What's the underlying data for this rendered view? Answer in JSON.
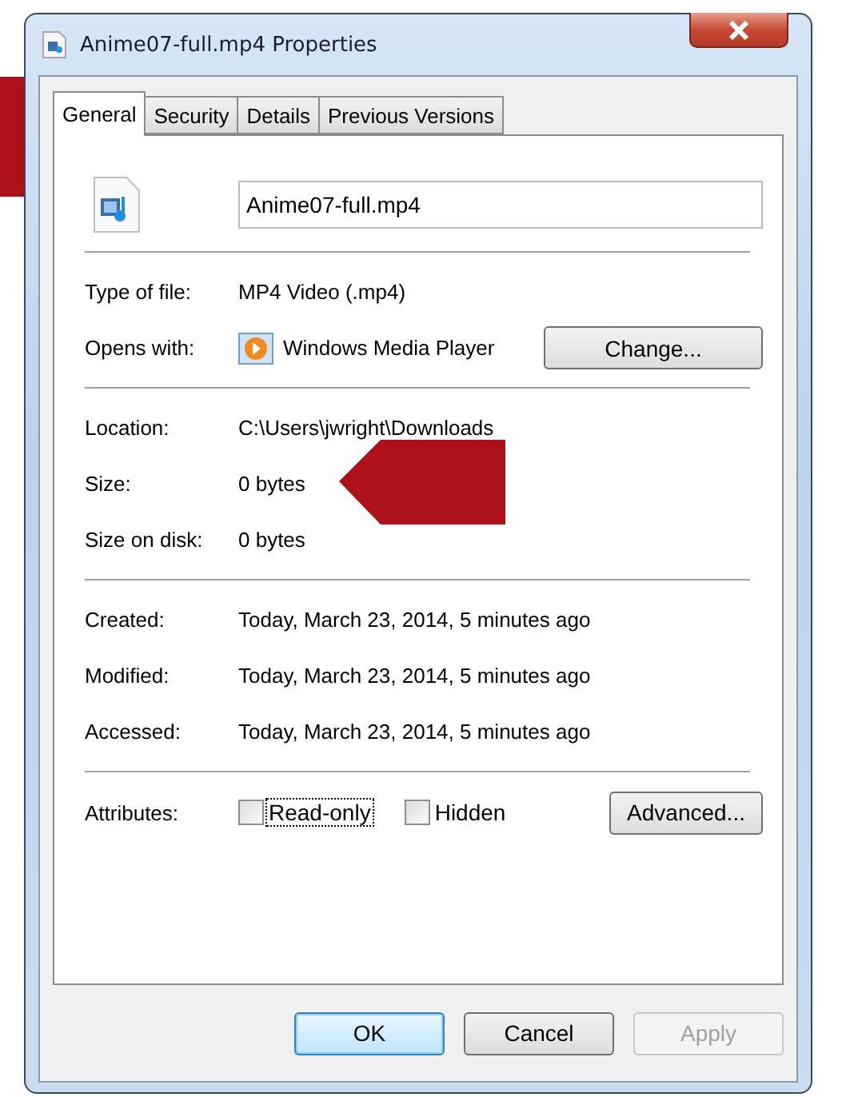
{
  "window": {
    "title": "Anime07-full.mp4 Properties"
  },
  "tabs": [
    {
      "label": "General",
      "selected": true
    },
    {
      "label": "Security",
      "selected": false
    },
    {
      "label": "Details",
      "selected": false
    },
    {
      "label": "Previous Versions",
      "selected": false
    }
  ],
  "file_name": {
    "value": "Anime07-full.mp4"
  },
  "sections": [
    [
      {
        "label": "Type of file:",
        "value": "MP4 Video (.mp4)",
        "kind": "text"
      },
      {
        "label": "Opens with:",
        "value": "Windows Media Player",
        "kind": "app",
        "button": "Change..."
      }
    ],
    [
      {
        "label": "Location:",
        "value": "C:\\Users\\jwright\\Downloads",
        "kind": "text"
      },
      {
        "label": "Size:",
        "value": "0 bytes",
        "kind": "text"
      },
      {
        "label": "Size on disk:",
        "value": "0 bytes",
        "kind": "text"
      }
    ],
    [
      {
        "label": "Created:",
        "value": "Today, March 23, 2014, 5 minutes ago",
        "kind": "text"
      },
      {
        "label": "Modified:",
        "value": "Today, March 23, 2014, 5 minutes ago",
        "kind": "text"
      },
      {
        "label": "Accessed:",
        "value": "Today, March 23, 2014, 5 minutes ago",
        "kind": "text"
      }
    ]
  ],
  "attributes": {
    "label": "Attributes:",
    "checkboxes": [
      {
        "label": "Read-only",
        "checked": false,
        "focused": true
      },
      {
        "label": "Hidden",
        "checked": false,
        "focused": false
      }
    ],
    "button": "Advanced..."
  },
  "buttons": [
    {
      "label": "OK",
      "default": true,
      "disabled": false
    },
    {
      "label": "Cancel",
      "default": false,
      "disabled": false
    },
    {
      "label": "Apply",
      "default": false,
      "disabled": true
    }
  ]
}
